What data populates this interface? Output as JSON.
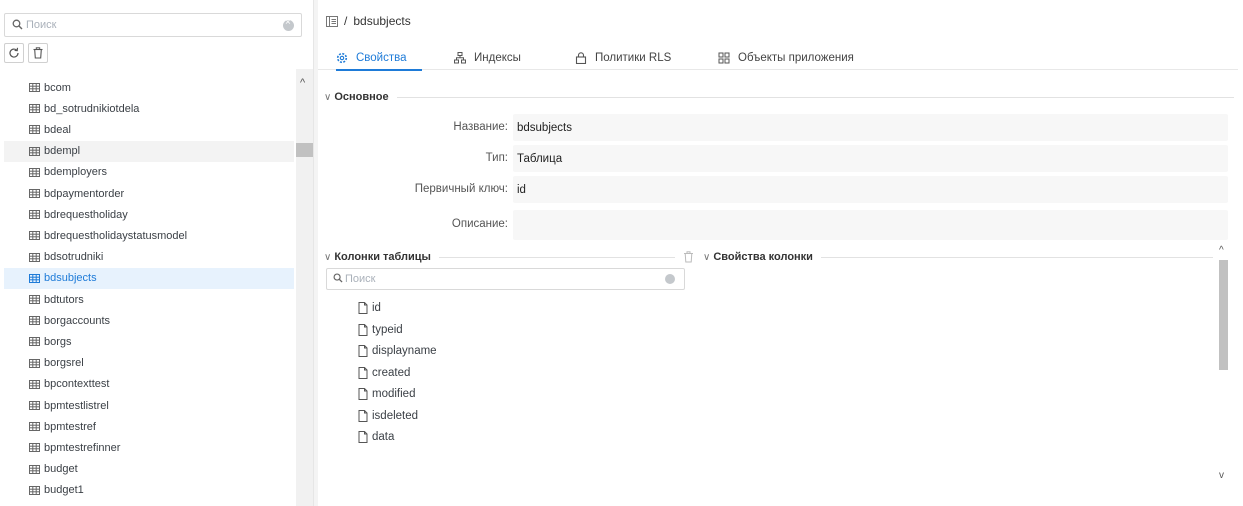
{
  "sidebar": {
    "search_placeholder": "Поиск",
    "tables": [
      "bcom",
      "bd_sotrudnikiotdela",
      "bdeal",
      "bdempl",
      "bdemployers",
      "bdpaymentorder",
      "bdrequestholiday",
      "bdrequestholidaystatusmodel",
      "bdsotrudniki",
      "bdsubjects",
      "bdtutors",
      "borgaccounts",
      "borgs",
      "borgsrel",
      "bpcontexttest",
      "bpmtestlistrel",
      "bpmtestref",
      "bpmtestrefinner",
      "budget",
      "budget1"
    ],
    "selected_table": "bdsubjects",
    "hovered_table": "bdempl"
  },
  "breadcrumb": {
    "separator": "/",
    "current": "bdsubjects"
  },
  "tabs": [
    {
      "label": "Свойства",
      "icon": "gear-icon",
      "active": true
    },
    {
      "label": "Индексы",
      "icon": "hierarchy-icon",
      "active": false
    },
    {
      "label": "Политики RLS",
      "icon": "lock-icon",
      "active": false
    },
    {
      "label": "Объекты приложения",
      "icon": "grid-icon",
      "active": false
    }
  ],
  "basic": {
    "title": "Основное",
    "fields": [
      {
        "label": "Название:",
        "value": "bdsubjects"
      },
      {
        "label": "Тип:",
        "value": "Таблица"
      },
      {
        "label": "Первичный ключ:",
        "value": "id"
      },
      {
        "label": "Описание:",
        "value": ""
      }
    ]
  },
  "columns": {
    "title": "Колонки таблицы",
    "search_placeholder": "Поиск",
    "items": [
      "id",
      "typeid",
      "displayname",
      "created",
      "modified",
      "isdeleted",
      "data"
    ]
  },
  "column_props": {
    "title": "Свойства колонки"
  },
  "colors": {
    "accent": "#1e7bd8",
    "selected_bg": "#e7f2fd",
    "field_bg": "#f7f7f7"
  }
}
